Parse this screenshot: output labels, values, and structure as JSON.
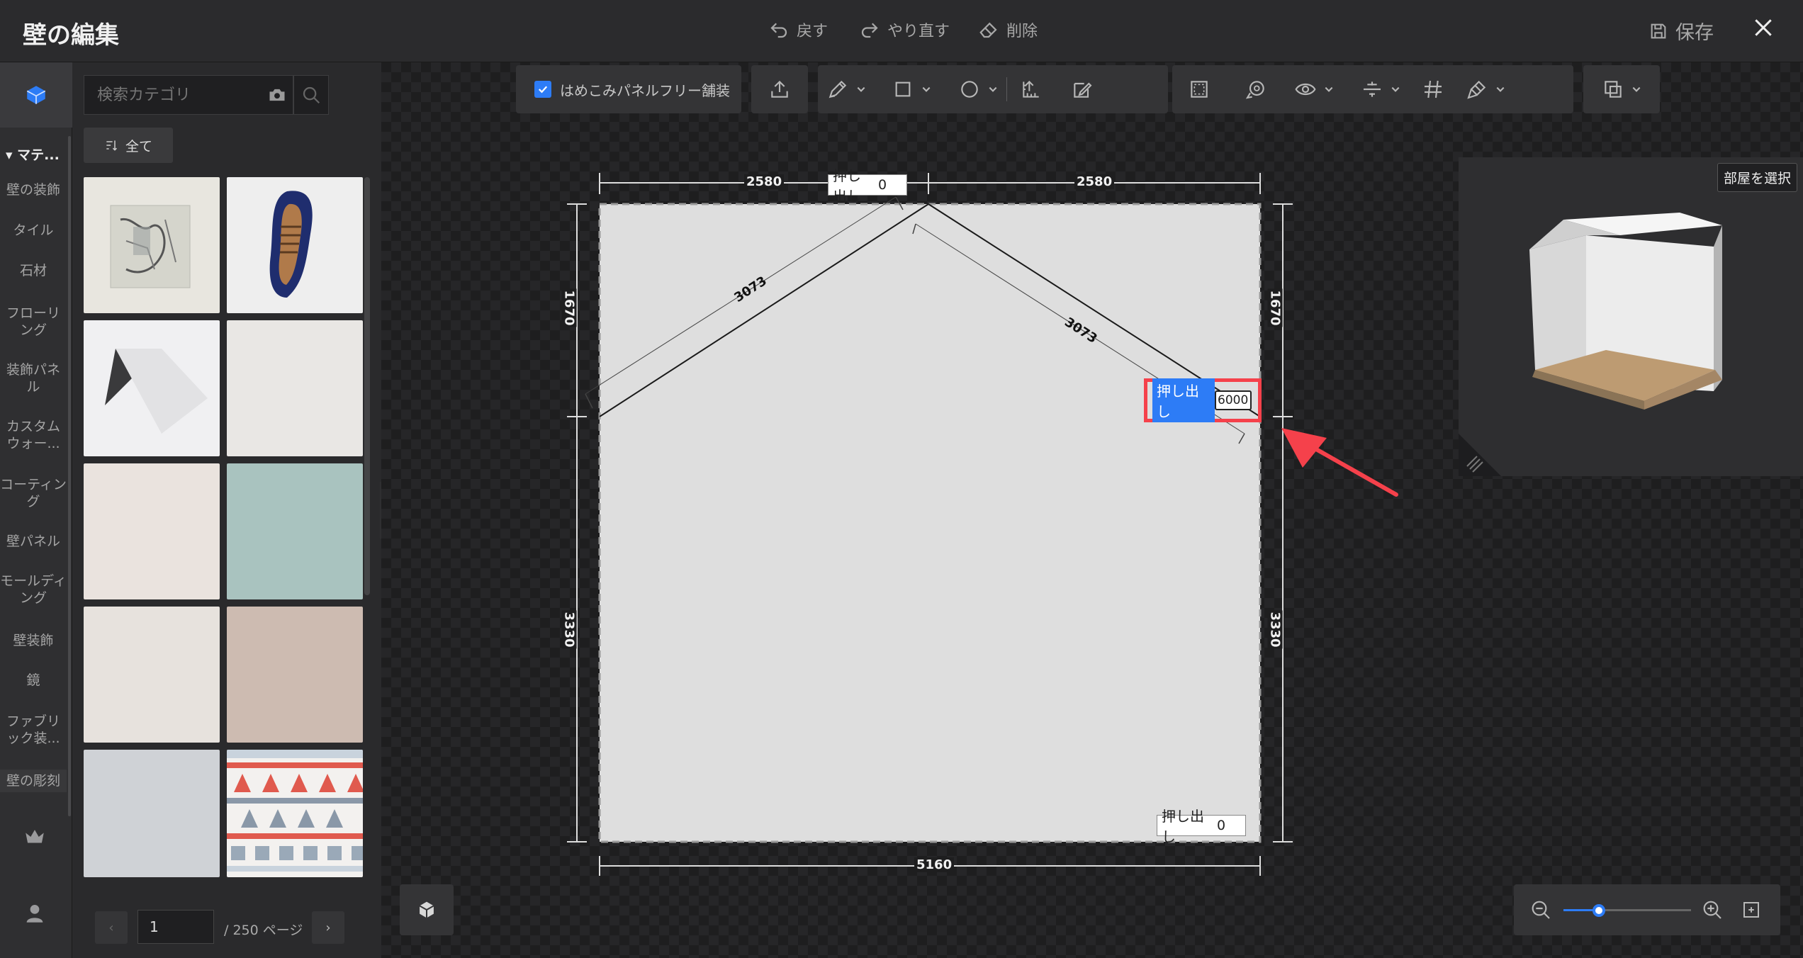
{
  "titlebar": {
    "title": "壁の編集",
    "undo": "戻す",
    "redo": "やり直す",
    "delete": "削除",
    "save": "保存"
  },
  "rail": {
    "section": "マテ...",
    "items": [
      "壁の装飾",
      "タイル",
      "石材",
      "フローリング",
      "装飾パネル",
      "カスタムウォー...",
      "コーティング",
      "壁パネル",
      "モールディング",
      "壁装飾",
      "鏡",
      "ファブリック装...",
      "壁の彫刻"
    ]
  },
  "panel": {
    "search_placeholder": "検索カテゴリ",
    "filter_label": "全て",
    "page_value": "1",
    "page_total": "/ 250 ページ"
  },
  "toolbar": {
    "seamless_label": "はめこみパネルフリー舗装",
    "seamless_checked": true
  },
  "dimensions": {
    "top_left": "2580",
    "top_right": "2580",
    "slope_left": "3073",
    "slope_right": "3073",
    "left_upper": "1670",
    "left_lower": "3330",
    "right_upper": "1670",
    "right_lower": "3330",
    "bottom": "5160"
  },
  "extrusions": {
    "label": "押し出し",
    "top_value": "0",
    "right_value": "6000",
    "wall_value": "0"
  },
  "preview": {
    "select_room": "部屋を選択"
  },
  "zoom": {
    "level": 0.28
  },
  "colors": {
    "accent": "#2d7cf6",
    "highlight": "#f5414b",
    "wall": "#dedede"
  }
}
